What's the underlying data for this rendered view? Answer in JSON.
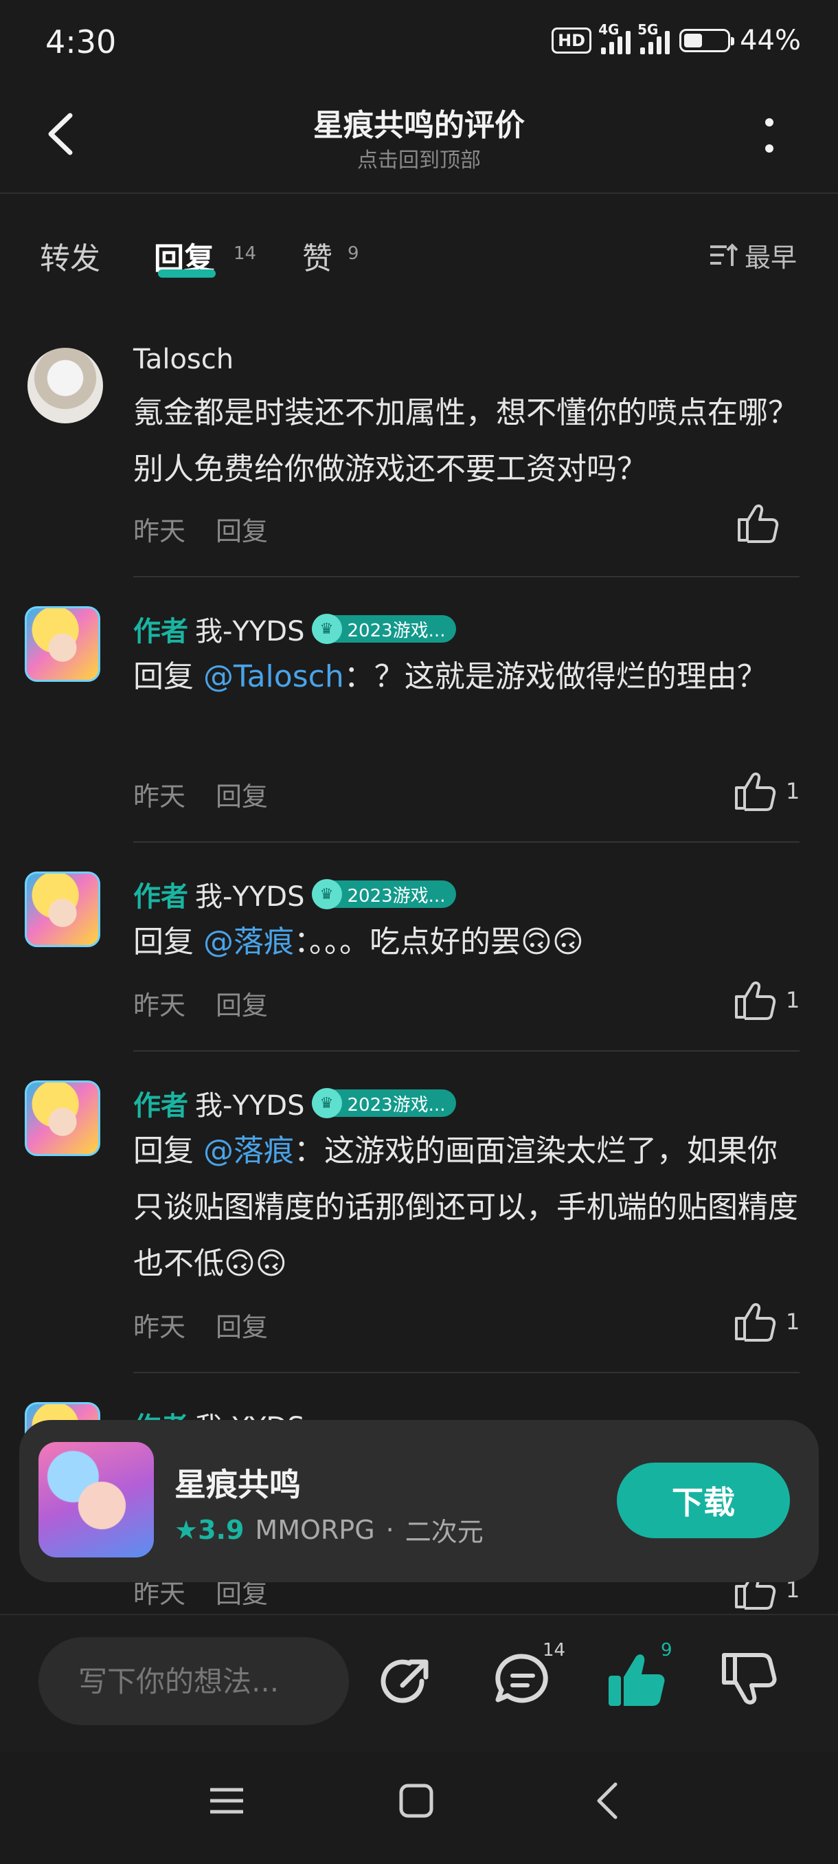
{
  "status_bar": {
    "time": "4:30",
    "hd": "HD",
    "net1": "4G",
    "net2": "5G",
    "battery": "44%",
    "battery_level": 0.44
  },
  "header": {
    "title": "星痕共鸣的评价",
    "subtitle": "点击回到顶部"
  },
  "tabs": [
    {
      "label": "转发",
      "count": ""
    },
    {
      "label": "回复",
      "count": "14"
    },
    {
      "label": "赞",
      "count": "9"
    }
  ],
  "sort_label": "最早",
  "comments": [
    {
      "author_tag": "",
      "user": "Talosch",
      "badge": "",
      "reply_prefix": "",
      "mention": "",
      "text": "氪金都是时装还不加属性，想不懂你的喷点在哪？别人免费给你做游戏还不要工资对吗？",
      "time": "昨天",
      "reply": "回复",
      "likes": ""
    },
    {
      "author_tag": "作者",
      "user": "我-YYDS",
      "badge": "2023游戏...",
      "reply_prefix": "回复",
      "mention": "@Talosch",
      "text": "：？这就是游戏做得烂的理由？",
      "time": "昨天",
      "reply": "回复",
      "likes": "1"
    },
    {
      "author_tag": "作者",
      "user": "我-YYDS",
      "badge": "2023游戏...",
      "reply_prefix": "回复",
      "mention": "@落痕",
      "text": "：。。。吃点好的罢🙃🙃",
      "time": "昨天",
      "reply": "回复",
      "likes": "1"
    },
    {
      "author_tag": "作者",
      "user": "我-YYDS",
      "badge": "2023游戏...",
      "reply_prefix": "回复",
      "mention": "@落痕",
      "text": "：这游戏的画面渲染太烂了，如果你只谈贴图精度的话那倒还可以，手机端的贴图精度也不低🙃🙃",
      "time": "昨天",
      "reply": "回复",
      "likes": "1"
    }
  ],
  "partial_row": {
    "author_tag": "作者",
    "user": "我-YYDS",
    "time": "昨天",
    "reply": "回复",
    "likes": "1"
  },
  "app_card": {
    "name": "星痕共鸣",
    "rating": "3.9",
    "genre": "MMORPG",
    "dot": "·",
    "tag": "二次元",
    "download": "下载"
  },
  "bottom_bar": {
    "input_placeholder": "写下你的想法...",
    "reply_count": "14",
    "like_count": "9"
  },
  "colors": {
    "accent": "#19b5a2",
    "mention": "#4aa3e8",
    "background": "#1b1b1b"
  }
}
